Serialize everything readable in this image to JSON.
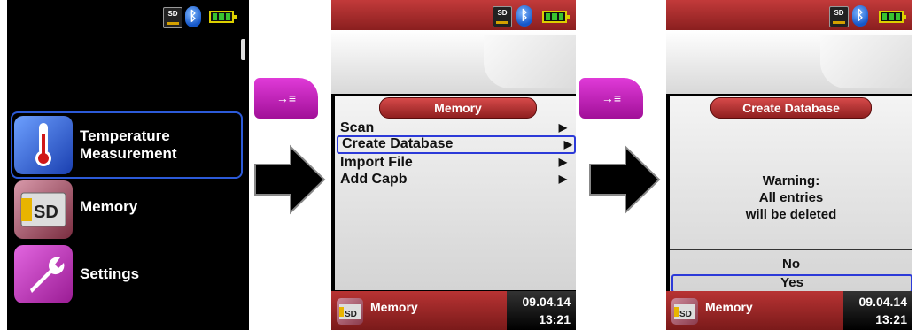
{
  "status": {
    "sd_label": "SD"
  },
  "screen1": {
    "items": [
      {
        "label_line1": "Temperature",
        "label_line2": "Measurement",
        "icon": "thermometer-icon"
      },
      {
        "label_line1": "Memory",
        "label_line2": "",
        "icon": "sd-card-icon"
      },
      {
        "label_line1": "Settings",
        "label_line2": "",
        "icon": "wrench-icon"
      }
    ],
    "tile_sd": "SD"
  },
  "screen2": {
    "title": "Memory",
    "items": [
      {
        "label": "Scan"
      },
      {
        "label": "Create Database"
      },
      {
        "label": "Import File"
      },
      {
        "label": "Add Capb"
      }
    ]
  },
  "screen3": {
    "title": "Create Database",
    "warning_line1": "Warning:",
    "warning_line2": "All entries",
    "warning_line3": "will be deleted",
    "option_no": "No",
    "option_yes": "Yes"
  },
  "footer": {
    "label": "Memory",
    "date": "09.04.14",
    "time": "13:21",
    "tile_sd": "SD"
  },
  "tab_symbol": "→≡",
  "colors": {
    "accent_red": "#a82828",
    "select_blue": "#2c5ad8",
    "magenta": "#d020c8"
  }
}
